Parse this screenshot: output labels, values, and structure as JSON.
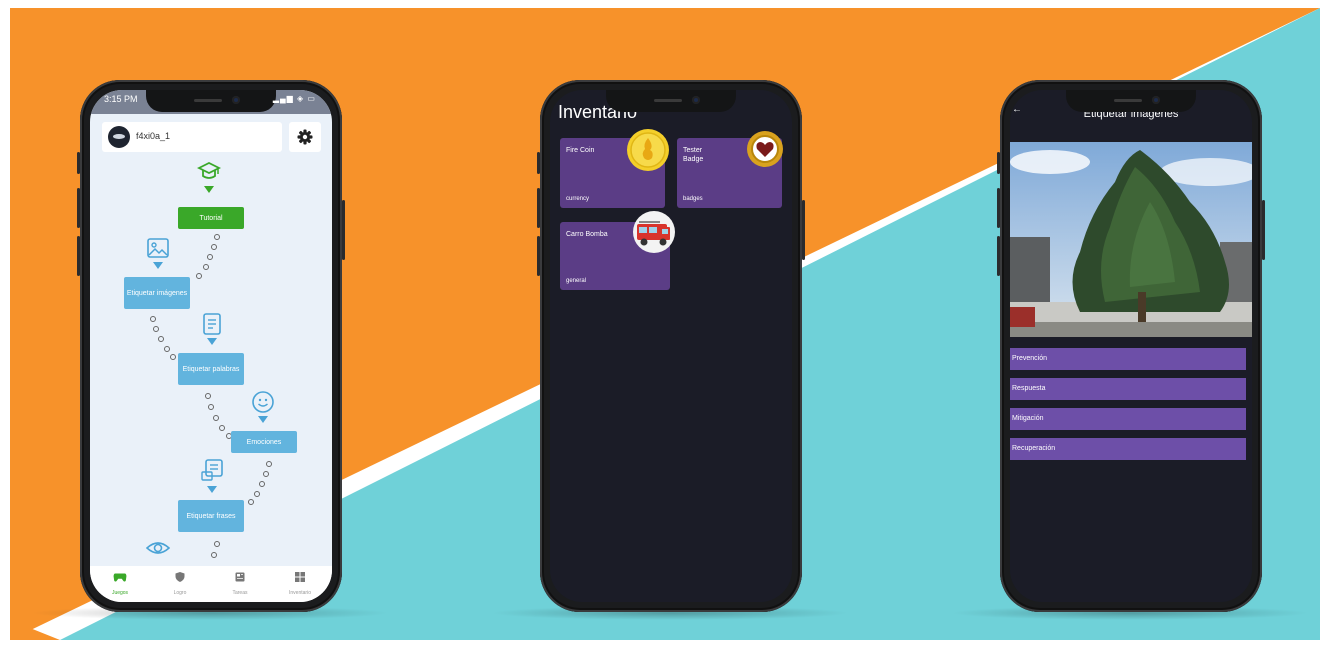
{
  "colors": {
    "orange": "#f7922a",
    "teal": "#6fd1d8",
    "purple_card": "#5b3d86",
    "purple_option": "#6d4fa8",
    "green": "#3aa829",
    "blue_node": "#62b4de",
    "dark_screen": "#1b1c27"
  },
  "phone1": {
    "status_time": "3:15 PM",
    "username": "f4xi0a_1",
    "nodes": [
      "Tutorial",
      "Etiquetar imágenes",
      "Etiquetar palabras",
      "Emociones",
      "Etiquetar frases"
    ],
    "nav": [
      "Juegos",
      "Logro",
      "Tareas",
      "Inventario"
    ]
  },
  "phone2": {
    "title": "Inventario",
    "items": [
      {
        "name": "Fire Coin",
        "category": "currency"
      },
      {
        "name": "Tester Badge",
        "category": "badges"
      },
      {
        "name": "Carro Bomba",
        "category": "general"
      }
    ]
  },
  "phone3": {
    "title": "Etiquetar imágenes",
    "options": [
      "Prevención",
      "Respuesta",
      "Mitigación",
      "Recuperación"
    ]
  }
}
